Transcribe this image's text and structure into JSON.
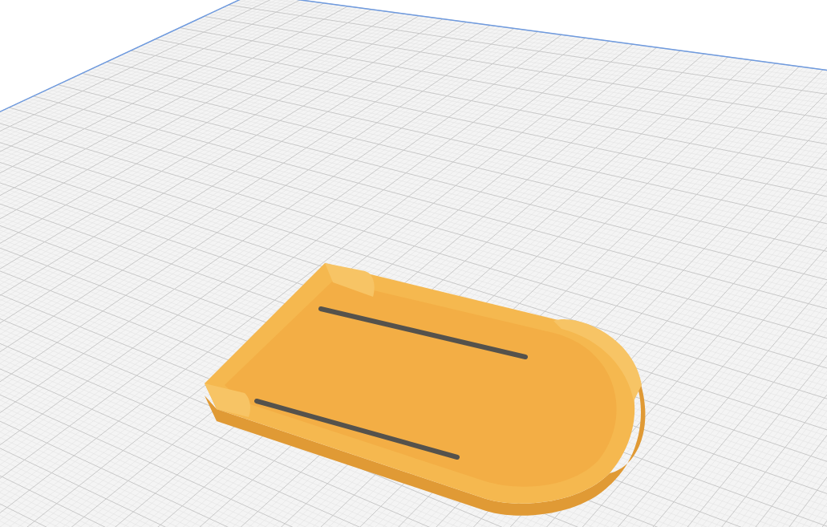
{
  "scene": {
    "models": [
      {
        "kind": "tray"
      }
    ]
  }
}
